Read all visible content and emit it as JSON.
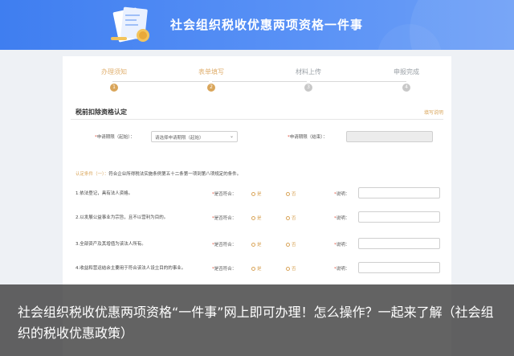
{
  "header": {
    "title": "社会组织税收优惠两项资格一件事"
  },
  "stepper": {
    "steps": [
      {
        "label": "办理须知",
        "number": "1",
        "state": "done"
      },
      {
        "label": "表单填写",
        "number": "2",
        "state": "active"
      },
      {
        "label": "材料上传",
        "number": "3",
        "state": "pending"
      },
      {
        "label": "申报完成",
        "number": "4",
        "state": "pending"
      }
    ]
  },
  "section": {
    "title": "税前扣除资格认定",
    "link": "填写说明"
  },
  "form": {
    "start_label": "申请期限（起始）：",
    "start_value": "请选择申请期限（起始）",
    "end_label": "申请期限（结束）："
  },
  "condition": {
    "prefix": "认定条件（一）：",
    "text": "符合企业所得税法实施条例第五十二条第一项到第八项规定的条件。"
  },
  "rows": [
    {
      "text": "1.依法登记，具有法人资格。",
      "q": "是否符合：",
      "yes": "是",
      "no": "否",
      "exp": "说明："
    },
    {
      "text": "2.以发展公益事业为宗旨，且不以营利为目的。",
      "q": "是否符合：",
      "yes": "是",
      "no": "否",
      "exp": "说明："
    },
    {
      "text": "3.全部资产及其增值为该法人所有。",
      "q": "是否符合：",
      "yes": "是",
      "no": "否",
      "exp": "说明："
    },
    {
      "text": "4.收益和营运结余主要用于符合该法人设立目的的事业。",
      "q": "是否符合：",
      "yes": "是",
      "no": "否",
      "exp": "说明："
    }
  ],
  "caption": {
    "text": "社会组织税收优惠两项资格“一件事”网上即可办理！怎么操作？一起来了解（社会组织的税收优惠政策）"
  },
  "colors": {
    "banner": "#4a86f2",
    "accent": "#d9a55a",
    "required": "#e0553f"
  }
}
